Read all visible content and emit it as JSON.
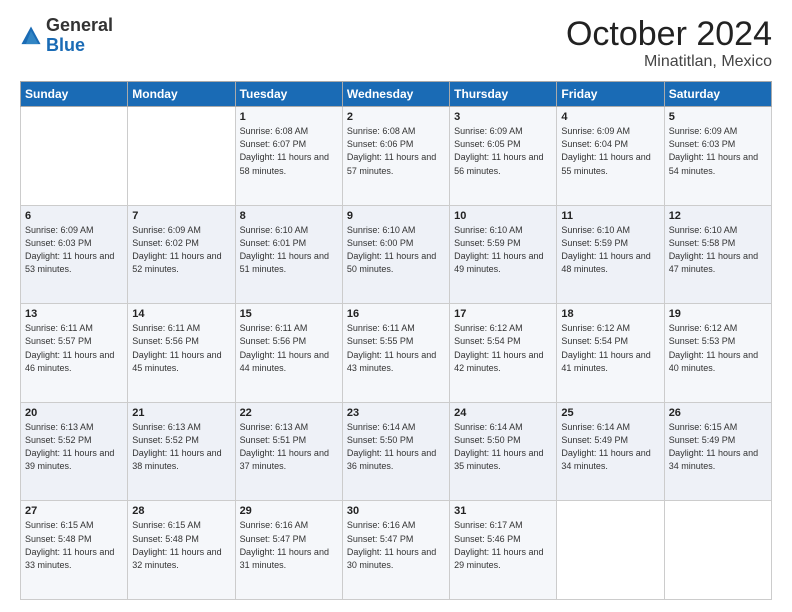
{
  "logo": {
    "general": "General",
    "blue": "Blue"
  },
  "title": "October 2024",
  "location": "Minatitlan, Mexico",
  "days_header": [
    "Sunday",
    "Monday",
    "Tuesday",
    "Wednesday",
    "Thursday",
    "Friday",
    "Saturday"
  ],
  "weeks": [
    [
      {
        "day": "",
        "sunrise": "",
        "sunset": "",
        "daylight": ""
      },
      {
        "day": "",
        "sunrise": "",
        "sunset": "",
        "daylight": ""
      },
      {
        "day": "1",
        "sunrise": "Sunrise: 6:08 AM",
        "sunset": "Sunset: 6:07 PM",
        "daylight": "Daylight: 11 hours and 58 minutes."
      },
      {
        "day": "2",
        "sunrise": "Sunrise: 6:08 AM",
        "sunset": "Sunset: 6:06 PM",
        "daylight": "Daylight: 11 hours and 57 minutes."
      },
      {
        "day": "3",
        "sunrise": "Sunrise: 6:09 AM",
        "sunset": "Sunset: 6:05 PM",
        "daylight": "Daylight: 11 hours and 56 minutes."
      },
      {
        "day": "4",
        "sunrise": "Sunrise: 6:09 AM",
        "sunset": "Sunset: 6:04 PM",
        "daylight": "Daylight: 11 hours and 55 minutes."
      },
      {
        "day": "5",
        "sunrise": "Sunrise: 6:09 AM",
        "sunset": "Sunset: 6:03 PM",
        "daylight": "Daylight: 11 hours and 54 minutes."
      }
    ],
    [
      {
        "day": "6",
        "sunrise": "Sunrise: 6:09 AM",
        "sunset": "Sunset: 6:03 PM",
        "daylight": "Daylight: 11 hours and 53 minutes."
      },
      {
        "day": "7",
        "sunrise": "Sunrise: 6:09 AM",
        "sunset": "Sunset: 6:02 PM",
        "daylight": "Daylight: 11 hours and 52 minutes."
      },
      {
        "day": "8",
        "sunrise": "Sunrise: 6:10 AM",
        "sunset": "Sunset: 6:01 PM",
        "daylight": "Daylight: 11 hours and 51 minutes."
      },
      {
        "day": "9",
        "sunrise": "Sunrise: 6:10 AM",
        "sunset": "Sunset: 6:00 PM",
        "daylight": "Daylight: 11 hours and 50 minutes."
      },
      {
        "day": "10",
        "sunrise": "Sunrise: 6:10 AM",
        "sunset": "Sunset: 5:59 PM",
        "daylight": "Daylight: 11 hours and 49 minutes."
      },
      {
        "day": "11",
        "sunrise": "Sunrise: 6:10 AM",
        "sunset": "Sunset: 5:59 PM",
        "daylight": "Daylight: 11 hours and 48 minutes."
      },
      {
        "day": "12",
        "sunrise": "Sunrise: 6:10 AM",
        "sunset": "Sunset: 5:58 PM",
        "daylight": "Daylight: 11 hours and 47 minutes."
      }
    ],
    [
      {
        "day": "13",
        "sunrise": "Sunrise: 6:11 AM",
        "sunset": "Sunset: 5:57 PM",
        "daylight": "Daylight: 11 hours and 46 minutes."
      },
      {
        "day": "14",
        "sunrise": "Sunrise: 6:11 AM",
        "sunset": "Sunset: 5:56 PM",
        "daylight": "Daylight: 11 hours and 45 minutes."
      },
      {
        "day": "15",
        "sunrise": "Sunrise: 6:11 AM",
        "sunset": "Sunset: 5:56 PM",
        "daylight": "Daylight: 11 hours and 44 minutes."
      },
      {
        "day": "16",
        "sunrise": "Sunrise: 6:11 AM",
        "sunset": "Sunset: 5:55 PM",
        "daylight": "Daylight: 11 hours and 43 minutes."
      },
      {
        "day": "17",
        "sunrise": "Sunrise: 6:12 AM",
        "sunset": "Sunset: 5:54 PM",
        "daylight": "Daylight: 11 hours and 42 minutes."
      },
      {
        "day": "18",
        "sunrise": "Sunrise: 6:12 AM",
        "sunset": "Sunset: 5:54 PM",
        "daylight": "Daylight: 11 hours and 41 minutes."
      },
      {
        "day": "19",
        "sunrise": "Sunrise: 6:12 AM",
        "sunset": "Sunset: 5:53 PM",
        "daylight": "Daylight: 11 hours and 40 minutes."
      }
    ],
    [
      {
        "day": "20",
        "sunrise": "Sunrise: 6:13 AM",
        "sunset": "Sunset: 5:52 PM",
        "daylight": "Daylight: 11 hours and 39 minutes."
      },
      {
        "day": "21",
        "sunrise": "Sunrise: 6:13 AM",
        "sunset": "Sunset: 5:52 PM",
        "daylight": "Daylight: 11 hours and 38 minutes."
      },
      {
        "day": "22",
        "sunrise": "Sunrise: 6:13 AM",
        "sunset": "Sunset: 5:51 PM",
        "daylight": "Daylight: 11 hours and 37 minutes."
      },
      {
        "day": "23",
        "sunrise": "Sunrise: 6:14 AM",
        "sunset": "Sunset: 5:50 PM",
        "daylight": "Daylight: 11 hours and 36 minutes."
      },
      {
        "day": "24",
        "sunrise": "Sunrise: 6:14 AM",
        "sunset": "Sunset: 5:50 PM",
        "daylight": "Daylight: 11 hours and 35 minutes."
      },
      {
        "day": "25",
        "sunrise": "Sunrise: 6:14 AM",
        "sunset": "Sunset: 5:49 PM",
        "daylight": "Daylight: 11 hours and 34 minutes."
      },
      {
        "day": "26",
        "sunrise": "Sunrise: 6:15 AM",
        "sunset": "Sunset: 5:49 PM",
        "daylight": "Daylight: 11 hours and 34 minutes."
      }
    ],
    [
      {
        "day": "27",
        "sunrise": "Sunrise: 6:15 AM",
        "sunset": "Sunset: 5:48 PM",
        "daylight": "Daylight: 11 hours and 33 minutes."
      },
      {
        "day": "28",
        "sunrise": "Sunrise: 6:15 AM",
        "sunset": "Sunset: 5:48 PM",
        "daylight": "Daylight: 11 hours and 32 minutes."
      },
      {
        "day": "29",
        "sunrise": "Sunrise: 6:16 AM",
        "sunset": "Sunset: 5:47 PM",
        "daylight": "Daylight: 11 hours and 31 minutes."
      },
      {
        "day": "30",
        "sunrise": "Sunrise: 6:16 AM",
        "sunset": "Sunset: 5:47 PM",
        "daylight": "Daylight: 11 hours and 30 minutes."
      },
      {
        "day": "31",
        "sunrise": "Sunrise: 6:17 AM",
        "sunset": "Sunset: 5:46 PM",
        "daylight": "Daylight: 11 hours and 29 minutes."
      },
      {
        "day": "",
        "sunrise": "",
        "sunset": "",
        "daylight": ""
      },
      {
        "day": "",
        "sunrise": "",
        "sunset": "",
        "daylight": ""
      }
    ]
  ]
}
